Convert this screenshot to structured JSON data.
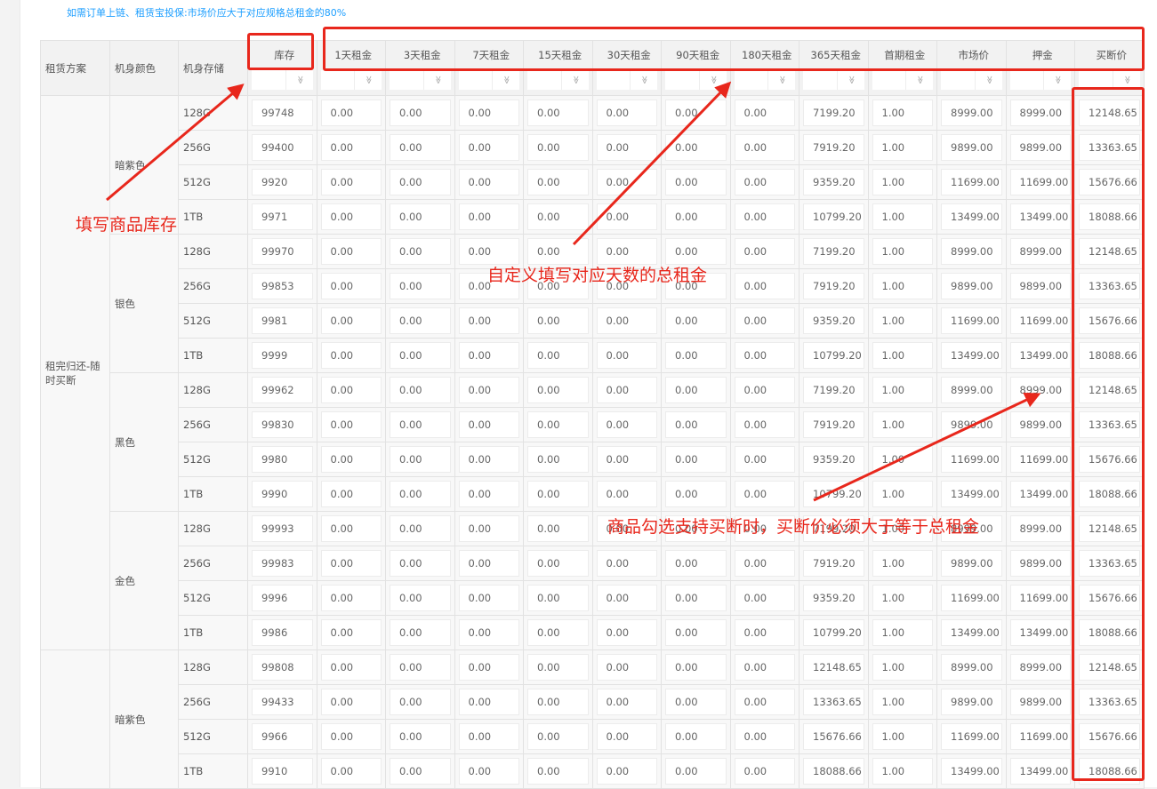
{
  "tip": "如需订单上链、租赁宝投保:市场价应大于对应规格总租金的80%",
  "headers": {
    "plan": "租赁方案",
    "color": "机身颜色",
    "storage": "机身存储",
    "columns": [
      "库存",
      "1天租金",
      "3天租金",
      "7天租金",
      "15天租金",
      "30天租金",
      "90天租金",
      "180天租金",
      "365天租金",
      "首期租金",
      "市场价",
      "押金",
      "买断价"
    ]
  },
  "filter_icon": "double-chevron-down-icon",
  "groups": [
    {
      "plan": "租完归还-随时买断",
      "colors": [
        {
          "name": "暗紫色",
          "rows": [
            {
              "storage": "128G",
              "values": [
                "99748",
                "0.00",
                "0.00",
                "0.00",
                "0.00",
                "0.00",
                "0.00",
                "0.00",
                "7199.20",
                "1.00",
                "8999.00",
                "8999.00",
                "12148.65"
              ]
            },
            {
              "storage": "256G",
              "values": [
                "99400",
                "0.00",
                "0.00",
                "0.00",
                "0.00",
                "0.00",
                "0.00",
                "0.00",
                "7919.20",
                "1.00",
                "9899.00",
                "9899.00",
                "13363.65"
              ]
            },
            {
              "storage": "512G",
              "values": [
                "9920",
                "0.00",
                "0.00",
                "0.00",
                "0.00",
                "0.00",
                "0.00",
                "0.00",
                "9359.20",
                "1.00",
                "11699.00",
                "11699.00",
                "15676.66"
              ]
            },
            {
              "storage": "1TB",
              "values": [
                "9971",
                "0.00",
                "0.00",
                "0.00",
                "0.00",
                "0.00",
                "0.00",
                "0.00",
                "10799.20",
                "1.00",
                "13499.00",
                "13499.00",
                "18088.66"
              ]
            }
          ]
        },
        {
          "name": "银色",
          "rows": [
            {
              "storage": "128G",
              "values": [
                "99970",
                "0.00",
                "0.00",
                "0.00",
                "0.00",
                "0.00",
                "0.00",
                "0.00",
                "7199.20",
                "1.00",
                "8999.00",
                "8999.00",
                "12148.65"
              ]
            },
            {
              "storage": "256G",
              "values": [
                "99853",
                "0.00",
                "0.00",
                "0.00",
                "0.00",
                "0.00",
                "0.00",
                "0.00",
                "7919.20",
                "1.00",
                "9899.00",
                "9899.00",
                "13363.65"
              ]
            },
            {
              "storage": "512G",
              "values": [
                "9981",
                "0.00",
                "0.00",
                "0.00",
                "0.00",
                "0.00",
                "0.00",
                "0.00",
                "9359.20",
                "1.00",
                "11699.00",
                "11699.00",
                "15676.66"
              ]
            },
            {
              "storage": "1TB",
              "values": [
                "9999",
                "0.00",
                "0.00",
                "0.00",
                "0.00",
                "0.00",
                "0.00",
                "0.00",
                "10799.20",
                "1.00",
                "13499.00",
                "13499.00",
                "18088.66"
              ]
            }
          ]
        },
        {
          "name": "黑色",
          "rows": [
            {
              "storage": "128G",
              "values": [
                "99962",
                "0.00",
                "0.00",
                "0.00",
                "0.00",
                "0.00",
                "0.00",
                "0.00",
                "7199.20",
                "1.00",
                "8999.00",
                "8999.00",
                "12148.65"
              ]
            },
            {
              "storage": "256G",
              "values": [
                "99830",
                "0.00",
                "0.00",
                "0.00",
                "0.00",
                "0.00",
                "0.00",
                "0.00",
                "7919.20",
                "1.00",
                "9899.00",
                "9899.00",
                "13363.65"
              ]
            },
            {
              "storage": "512G",
              "values": [
                "9980",
                "0.00",
                "0.00",
                "0.00",
                "0.00",
                "0.00",
                "0.00",
                "0.00",
                "9359.20",
                "1.00",
                "11699.00",
                "11699.00",
                "15676.66"
              ]
            },
            {
              "storage": "1TB",
              "values": [
                "9990",
                "0.00",
                "0.00",
                "0.00",
                "0.00",
                "0.00",
                "0.00",
                "0.00",
                "10799.20",
                "1.00",
                "13499.00",
                "13499.00",
                "18088.66"
              ]
            }
          ]
        },
        {
          "name": "金色",
          "rows": [
            {
              "storage": "128G",
              "values": [
                "99993",
                "0.00",
                "0.00",
                "0.00",
                "0.00",
                "0.00",
                "0.00",
                "0.00",
                "7199.20",
                "1.00",
                "8999.00",
                "8999.00",
                "12148.65"
              ]
            },
            {
              "storage": "256G",
              "values": [
                "99983",
                "0.00",
                "0.00",
                "0.00",
                "0.00",
                "0.00",
                "0.00",
                "0.00",
                "7919.20",
                "1.00",
                "9899.00",
                "9899.00",
                "13363.65"
              ]
            },
            {
              "storage": "512G",
              "values": [
                "9996",
                "0.00",
                "0.00",
                "0.00",
                "0.00",
                "0.00",
                "0.00",
                "0.00",
                "9359.20",
                "1.00",
                "11699.00",
                "11699.00",
                "15676.66"
              ]
            },
            {
              "storage": "1TB",
              "values": [
                "9986",
                "0.00",
                "0.00",
                "0.00",
                "0.00",
                "0.00",
                "0.00",
                "0.00",
                "10799.20",
                "1.00",
                "13499.00",
                "13499.00",
                "18088.66"
              ]
            }
          ]
        }
      ]
    },
    {
      "plan": "",
      "colors": [
        {
          "name": "暗紫色",
          "rows": [
            {
              "storage": "128G",
              "values": [
                "99808",
                "0.00",
                "0.00",
                "0.00",
                "0.00",
                "0.00",
                "0.00",
                "0.00",
                "12148.65",
                "1.00",
                "8999.00",
                "8999.00",
                "12148.65"
              ]
            },
            {
              "storage": "256G",
              "values": [
                "99433",
                "0.00",
                "0.00",
                "0.00",
                "0.00",
                "0.00",
                "0.00",
                "0.00",
                "13363.65",
                "1.00",
                "9899.00",
                "9899.00",
                "13363.65"
              ]
            },
            {
              "storage": "512G",
              "values": [
                "9966",
                "0.00",
                "0.00",
                "0.00",
                "0.00",
                "0.00",
                "0.00",
                "0.00",
                "15676.66",
                "1.00",
                "11699.00",
                "11699.00",
                "15676.66"
              ]
            },
            {
              "storage": "1TB",
              "values": [
                "9910",
                "0.00",
                "0.00",
                "0.00",
                "0.00",
                "0.00",
                "0.00",
                "0.00",
                "18088.66",
                "1.00",
                "13499.00",
                "13499.00",
                "18088.66"
              ]
            }
          ]
        }
      ]
    }
  ],
  "annotations": {
    "stock": "填写商品库存",
    "rent": "自定义填写对应天数的总租金",
    "buyout": "商品勾选支持买断时，买断价必须大于等于总租金"
  },
  "colors": {
    "annotation": "#e8271c",
    "tip": "#1e9fff"
  }
}
